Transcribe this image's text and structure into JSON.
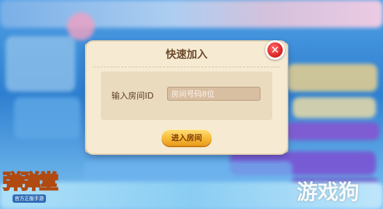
{
  "dialog": {
    "title": "快速加入",
    "field_label": "输入房间ID",
    "room_input": {
      "value": "",
      "placeholder": "房间号码8位"
    },
    "join_button_label": "进入房间",
    "close_icon": "close-icon"
  },
  "logo": {
    "title": "弹弹堂",
    "subtitle": "官方正版手游"
  },
  "watermark": "游戏狗",
  "colors": {
    "dialog_bg": "#f6ead3",
    "title_text": "#6b4a2c",
    "join_button": "#f6b733",
    "close_button": "#d81e1e"
  }
}
